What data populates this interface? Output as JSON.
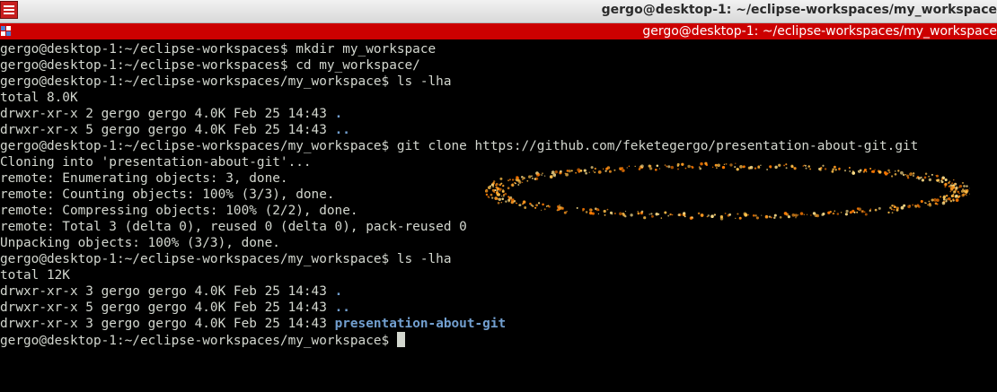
{
  "window": {
    "title": "gergo@desktop-1: ~/eclipse-workspaces/my_workspace",
    "tab_title": "gergo@desktop-1: ~/eclipse-workspaces/my_workspace",
    "menu_icon": "window-menu-icon",
    "tab_icon": "terminal-tab-icon"
  },
  "colors": {
    "titlebar": "#e6e6e6",
    "tab_bar": "#cc0000",
    "background": "#000000",
    "text": "#d3d7cf",
    "directory": "#729fcf",
    "highlight": "#ff9a1f"
  },
  "terminal": {
    "lines": [
      {
        "segments": [
          {
            "text": "gergo@desktop-1:~/eclipse-workspaces$ mkdir my_workspace"
          }
        ]
      },
      {
        "segments": [
          {
            "text": "gergo@desktop-1:~/eclipse-workspaces$ cd my_workspace/"
          }
        ]
      },
      {
        "segments": [
          {
            "text": "gergo@desktop-1:~/eclipse-workspaces/my_workspace$ ls -lha"
          }
        ]
      },
      {
        "segments": [
          {
            "text": "total 8.0K"
          }
        ]
      },
      {
        "segments": [
          {
            "text": "drwxr-xr-x 2 gergo gergo 4.0K Feb 25 14:43 "
          },
          {
            "text": ".",
            "dir": true
          }
        ]
      },
      {
        "segments": [
          {
            "text": "drwxr-xr-x 5 gergo gergo 4.0K Feb 25 14:43 "
          },
          {
            "text": "..",
            "dir": true
          }
        ]
      },
      {
        "segments": [
          {
            "text": "gergo@desktop-1:~/eclipse-workspaces/my_workspace$ git clone https://github.com/feketegergo/presentation-about-git.git"
          }
        ]
      },
      {
        "segments": [
          {
            "text": "Cloning into 'presentation-about-git'..."
          }
        ]
      },
      {
        "segments": [
          {
            "text": "remote: Enumerating objects: 3, done."
          }
        ]
      },
      {
        "segments": [
          {
            "text": "remote: Counting objects: 100% (3/3), done."
          }
        ]
      },
      {
        "segments": [
          {
            "text": "remote: Compressing objects: 100% (2/2), done."
          }
        ]
      },
      {
        "segments": [
          {
            "text": "remote: Total 3 (delta 0), reused 0 (delta 0), pack-reused 0"
          }
        ]
      },
      {
        "segments": [
          {
            "text": "Unpacking objects: 100% (3/3), done."
          }
        ]
      },
      {
        "segments": [
          {
            "text": "gergo@desktop-1:~/eclipse-workspaces/my_workspace$ ls -lha"
          }
        ]
      },
      {
        "segments": [
          {
            "text": "total 12K"
          }
        ]
      },
      {
        "segments": [
          {
            "text": "drwxr-xr-x 3 gergo gergo 4.0K Feb 25 14:43 "
          },
          {
            "text": ".",
            "dir": true
          }
        ]
      },
      {
        "segments": [
          {
            "text": "drwxr-xr-x 5 gergo gergo 4.0K Feb 25 14:43 "
          },
          {
            "text": "..",
            "dir": true
          }
        ]
      },
      {
        "segments": [
          {
            "text": "drwxr-xr-x 3 gergo gergo 4.0K Feb 25 14:43 "
          },
          {
            "text": "presentation-about-git",
            "dir": true
          }
        ]
      },
      {
        "segments": [
          {
            "text": "gergo@desktop-1:~/eclipse-workspaces/my_workspace$ "
          }
        ],
        "cursor": true
      }
    ]
  }
}
